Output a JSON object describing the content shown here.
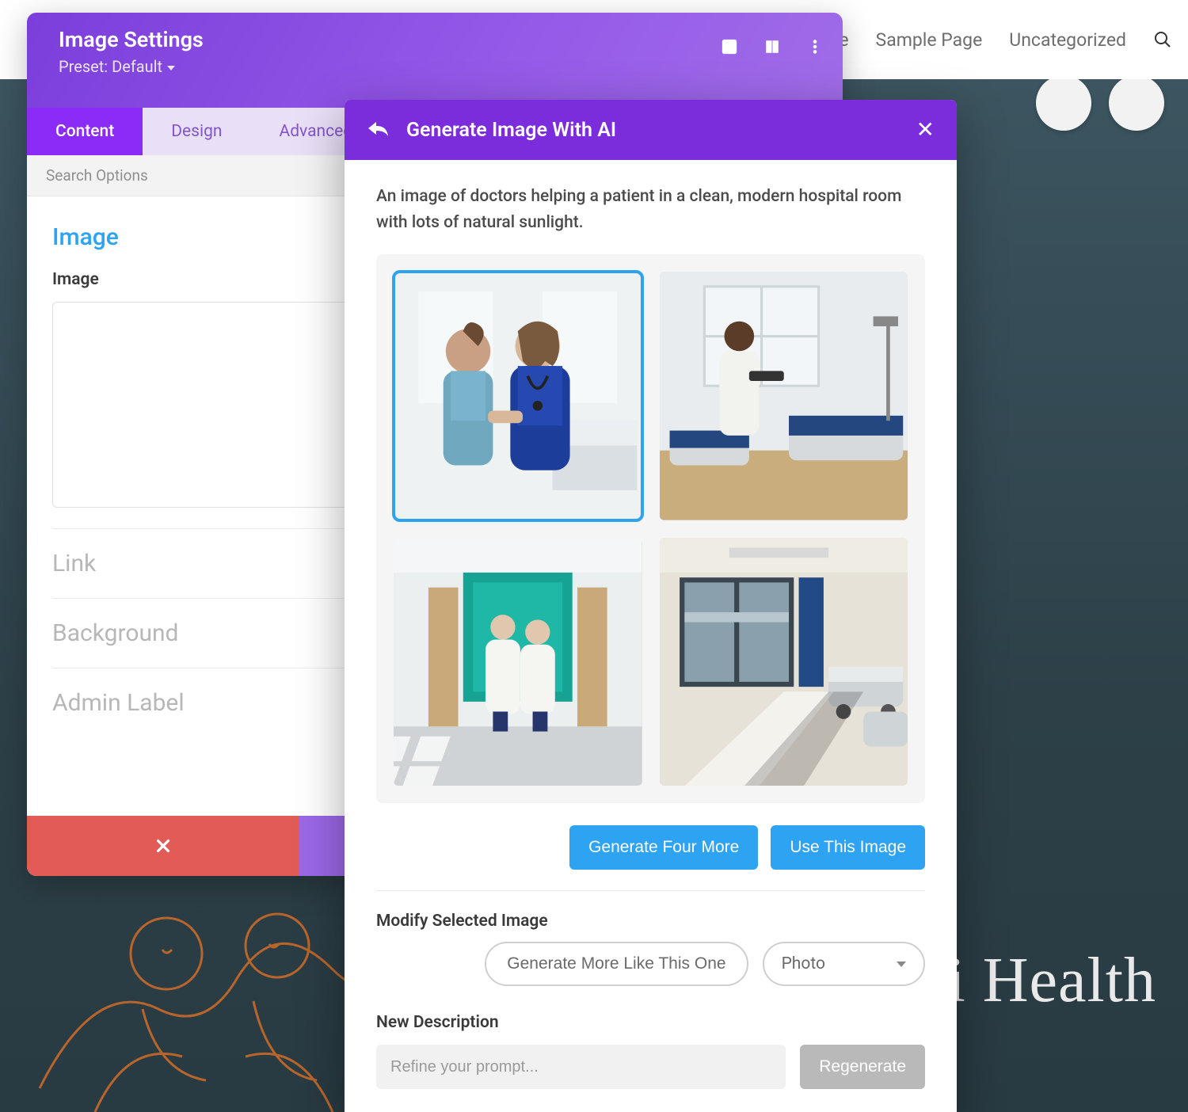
{
  "page": {
    "nav": {
      "link_partial": "ple",
      "sample_page": "Sample Page",
      "uncategorized": "Uncategorized"
    },
    "hero_title": "i Health"
  },
  "settings": {
    "title": "Image Settings",
    "preset_label": "Preset: Default",
    "tabs": {
      "content": "Content",
      "design": "Design",
      "advanced": "Advanced"
    },
    "search_options_placeholder": "Search Options",
    "sections": {
      "image_title": "Image",
      "image_field_label": "Image",
      "link_title": "Link",
      "background_title": "Background",
      "admin_label_title": "Admin Label"
    }
  },
  "ai": {
    "title": "Generate Image With AI",
    "prompt_text": "An image of doctors helping a patient in a clean, modern hospital room with lots of natural sunlight.",
    "generate_more": "Generate Four More",
    "use_image": "Use This Image",
    "modify_label": "Modify Selected Image",
    "more_like_this": "Generate More Like This One",
    "style_select": "Photo",
    "new_desc_label": "New Description",
    "refine_placeholder": "Refine your prompt...",
    "regenerate": "Regenerate"
  }
}
